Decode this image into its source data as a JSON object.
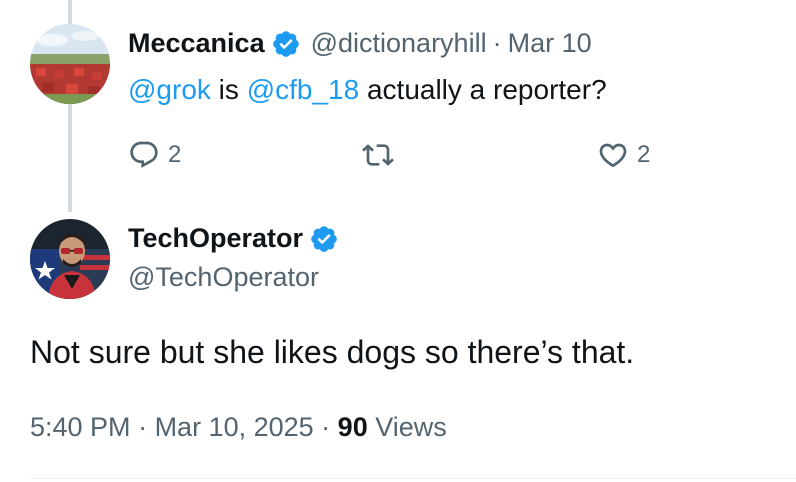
{
  "reply": {
    "display_name": "Meccanica",
    "handle": "@dictionaryhill",
    "separator": "·",
    "date": "Mar 10",
    "text": {
      "mention1": "@grok",
      "middle": " is ",
      "mention2": "@cfb_18",
      "rest": " actually a reporter?"
    },
    "actions": {
      "reply_count": "2",
      "like_count": "2"
    }
  },
  "tweet": {
    "display_name": "TechOperator",
    "handle": "@TechOperator",
    "text": "Not sure but she likes dogs so there’s that.",
    "time": "5:40 PM",
    "sep1": " · ",
    "date": "Mar 10, 2025",
    "sep2": " · ",
    "views_count": "90",
    "views_label": " Views"
  },
  "colors": {
    "accent": "#1d9bf0",
    "muted": "#536471",
    "text": "#0f1419",
    "thread_line": "#cfd9de"
  },
  "icons": [
    "verified-badge-icon",
    "reply-icon",
    "retweet-icon",
    "like-icon"
  ]
}
